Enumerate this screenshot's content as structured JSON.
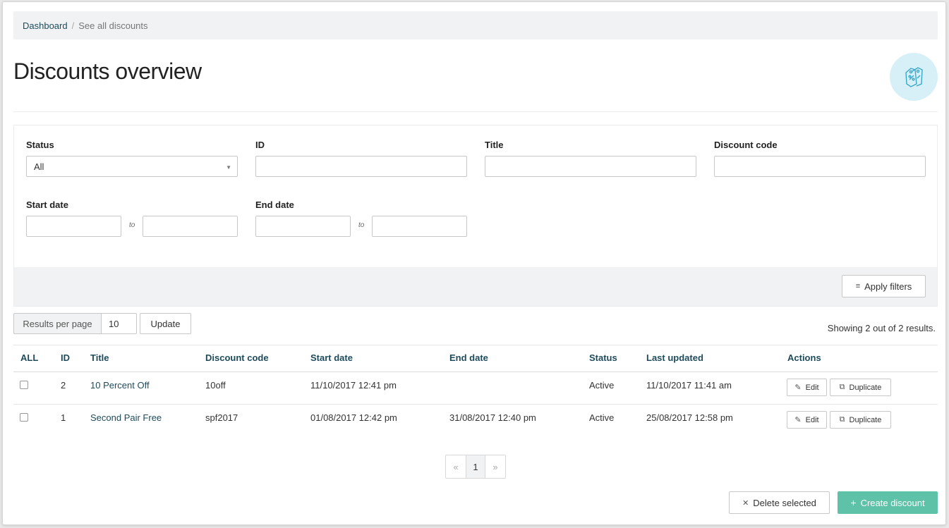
{
  "breadcrumb": {
    "home": "Dashboard",
    "separator": "/",
    "current": "See all discounts"
  },
  "page": {
    "title": "Discounts overview",
    "hero_icon": "price-tags-icon"
  },
  "filters": {
    "status": {
      "label": "Status",
      "value": "All"
    },
    "id": {
      "label": "ID",
      "value": ""
    },
    "title": {
      "label": "Title",
      "value": ""
    },
    "code": {
      "label": "Discount code",
      "value": ""
    },
    "start_date": {
      "label": "Start date",
      "from": "",
      "to_label": "to",
      "to": ""
    },
    "end_date": {
      "label": "End date",
      "from": "",
      "to_label": "to",
      "to": ""
    },
    "apply_label": "Apply filters"
  },
  "paging_controls": {
    "rpp_label": "Results per page",
    "rpp_value": "10",
    "update_label": "Update",
    "results_text": "Showing 2 out of 2 results."
  },
  "table": {
    "headers": {
      "all": "ALL",
      "id": "ID",
      "title": "Title",
      "code": "Discount code",
      "start": "Start date",
      "end": "End date",
      "status": "Status",
      "updated": "Last updated",
      "actions": "Actions"
    },
    "rows": [
      {
        "id": "2",
        "title": "10 Percent Off",
        "code": "10off",
        "start": "11/10/2017 12:41 pm",
        "end": "",
        "status": "Active",
        "updated": "11/10/2017 11:41 am",
        "edit": "Edit",
        "duplicate": "Duplicate"
      },
      {
        "id": "1",
        "title": "Second Pair Free",
        "code": "spf2017",
        "start": "01/08/2017 12:42 pm",
        "end": "31/08/2017 12:40 pm",
        "status": "Active",
        "updated": "25/08/2017 12:58 pm",
        "edit": "Edit",
        "duplicate": "Duplicate"
      }
    ]
  },
  "pagination": {
    "prev": "«",
    "current": "1",
    "next": "»"
  },
  "footer": {
    "delete_label": "Delete selected",
    "create_label": "Create discount"
  },
  "colors": {
    "accent": "#5ec2a9",
    "link": "#1e4b5c",
    "panel": "#f0f2f3",
    "hero_bg": "#d7f0f8"
  }
}
